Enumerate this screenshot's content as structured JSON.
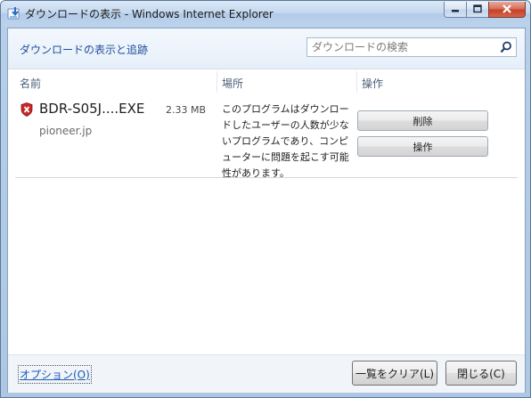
{
  "window": {
    "title": "ダウンロードの表示 - Windows Internet Explorer"
  },
  "header": {
    "view_title": "ダウンロードの表示と追跡",
    "search_placeholder": "ダウンロードの検索"
  },
  "columns": {
    "name": "名前",
    "location": "場所",
    "actions": "操作"
  },
  "downloads": [
    {
      "filename": "BDR-S05J....EXE",
      "size": "2.33 MB",
      "source": "pioneer.jp",
      "message": "このプログラムはダウンロードしたユーザーの人数が少ないプログラムであり、コンピューターに問題を起こす可能性があります。",
      "delete_label": "削除",
      "actions_label": "操作"
    }
  ],
  "footer": {
    "options_label": "オプション(O)",
    "clear_label": "一覧をクリア(L)",
    "close_label": "閉じる(C)"
  },
  "colors": {
    "title_blue": "#1e4e9a",
    "warning_red": "#c62828",
    "link_blue": "#1b57b5"
  },
  "icons": {
    "title": "ie-download-icon",
    "search": "search-icon",
    "warning": "security-warning-shield-icon"
  }
}
